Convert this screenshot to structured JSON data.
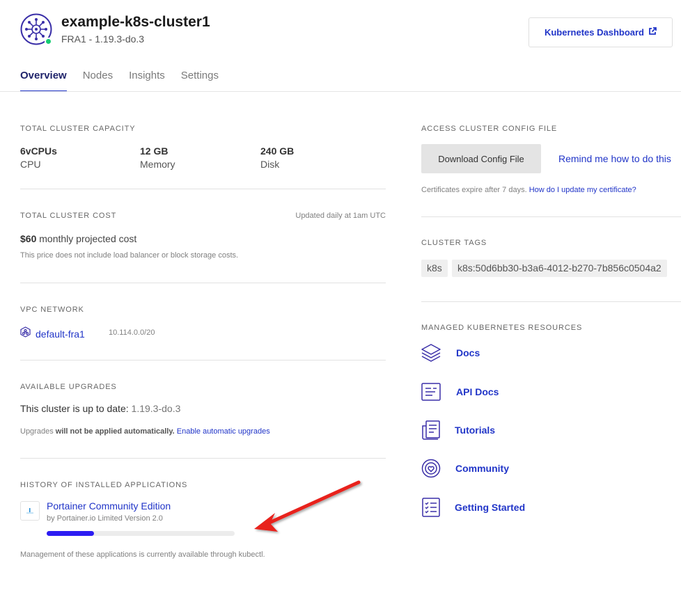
{
  "header": {
    "cluster_name": "example-k8s-cluster1",
    "cluster_sub": "FRA1 - 1.19.3-do.3",
    "dashboard_button": "Kubernetes Dashboard",
    "status_color": "#15cd72"
  },
  "tabs": [
    {
      "label": "Overview",
      "active": true
    },
    {
      "label": "Nodes",
      "active": false
    },
    {
      "label": "Insights",
      "active": false
    },
    {
      "label": "Settings",
      "active": false
    }
  ],
  "capacity": {
    "label": "TOTAL CLUSTER CAPACITY",
    "items": [
      {
        "value": "6vCPUs",
        "unit": "CPU"
      },
      {
        "value": "12 GB",
        "unit": "Memory"
      },
      {
        "value": "240 GB",
        "unit": "Disk"
      }
    ]
  },
  "cost": {
    "label": "TOTAL CLUSTER COST",
    "updated": "Updated daily at 1am UTC",
    "amount": "$60",
    "amount_suffix": "monthly projected cost",
    "note": "This price does not include load balancer or block storage costs."
  },
  "vpc": {
    "label": "VPC NETWORK",
    "name": "default-fra1",
    "range": "10.114.0.0/20"
  },
  "upgrades": {
    "label": "AVAILABLE UPGRADES",
    "status_prefix": "This cluster is up to date:",
    "version": "1.19.3-do.3",
    "note_prefix": "Upgrades",
    "note_bold": "will not be applied automatically.",
    "enable_link": "Enable automatic upgrades"
  },
  "history": {
    "label": "HISTORY OF INSTALLED APPLICATIONS",
    "app_name": "Portainer Community Edition",
    "app_meta": "by Portainer.io Limited Version 2.0",
    "progress": 0.25,
    "note": "Management of these applications is currently available through kubectl."
  },
  "config": {
    "label": "ACCESS CLUSTER CONFIG FILE",
    "download_button": "Download Config File",
    "remind_link": "Remind me how to do this",
    "cert_note": "Certificates expire after 7 days.",
    "cert_link": "How do I update my certificate?"
  },
  "tags": {
    "label": "CLUSTER TAGS",
    "items": [
      "k8s",
      "k8s:50d6bb30-b3a6-4012-b270-7b856c0504a2"
    ]
  },
  "resources": {
    "label": "MANAGED KUBERNETES RESOURCES",
    "items": [
      {
        "label": "Docs",
        "icon": "layers-icon"
      },
      {
        "label": "API Docs",
        "icon": "api-docs-icon"
      },
      {
        "label": "Tutorials",
        "icon": "tutorials-icon"
      },
      {
        "label": "Community",
        "icon": "community-icon"
      },
      {
        "label": "Getting Started",
        "icon": "checklist-icon"
      }
    ]
  },
  "colors": {
    "accent": "#2135c8",
    "arrow": "#e8201c"
  }
}
